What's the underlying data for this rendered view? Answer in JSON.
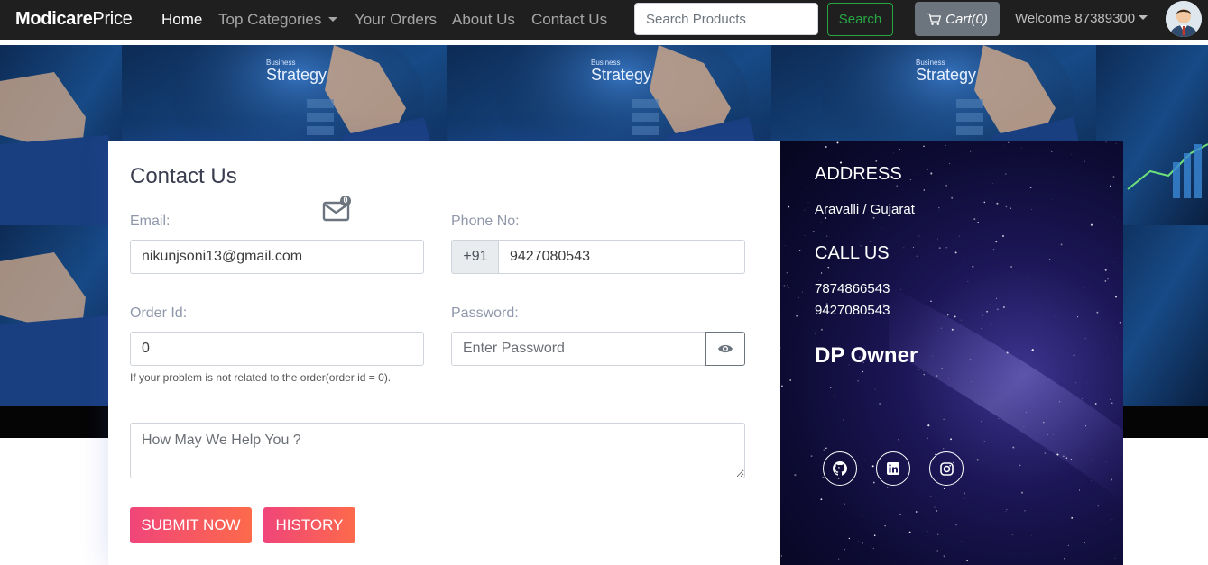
{
  "navbar": {
    "brand_bold": "Modicare",
    "brand_light": "Price",
    "links": [
      {
        "label": "Home"
      },
      {
        "label": "Top Categories"
      },
      {
        "label": "Your Orders"
      },
      {
        "label": "About Us"
      },
      {
        "label": "Contact Us"
      }
    ],
    "search_placeholder": "Search Products",
    "search_button": "Search",
    "cart_label": "Cart(0)",
    "welcome": "Welcome 87389300"
  },
  "hero": {
    "banner_text_small": "Business",
    "banner_text_large": "Strategy"
  },
  "contact_form": {
    "title": "Contact Us",
    "mail_badge": "0",
    "email_label": "Email:",
    "email_value": "nikunjsoni13@gmail.com",
    "phone_label": "Phone No:",
    "phone_prefix": "+91",
    "phone_value": "9427080543",
    "order_label": "Order Id:",
    "order_value": "0",
    "order_help": "If your problem is not related to the order(order id = 0).",
    "password_label": "Password:",
    "password_placeholder": "Enter Password",
    "message_placeholder": "How May We Help You ?",
    "submit_label": "SUBMIT NOW",
    "history_label": "HISTORY"
  },
  "info_panel": {
    "address_heading": "ADDRESS",
    "address": "Aravalli / Gujarat",
    "call_heading": "CALL US",
    "phones": [
      "7874866543",
      "9427080543"
    ],
    "owner": "DP Owner",
    "socials": [
      "github-icon",
      "linkedin-icon",
      "instagram-icon"
    ]
  },
  "colors": {
    "navbar_bg": "#1f1f1f",
    "search_green": "#28a745",
    "cart_gray": "#6c757d",
    "button_gradient_start": "#f0457a",
    "button_gradient_end": "#fd6a4b",
    "info_panel_bg": "#1c1656"
  }
}
